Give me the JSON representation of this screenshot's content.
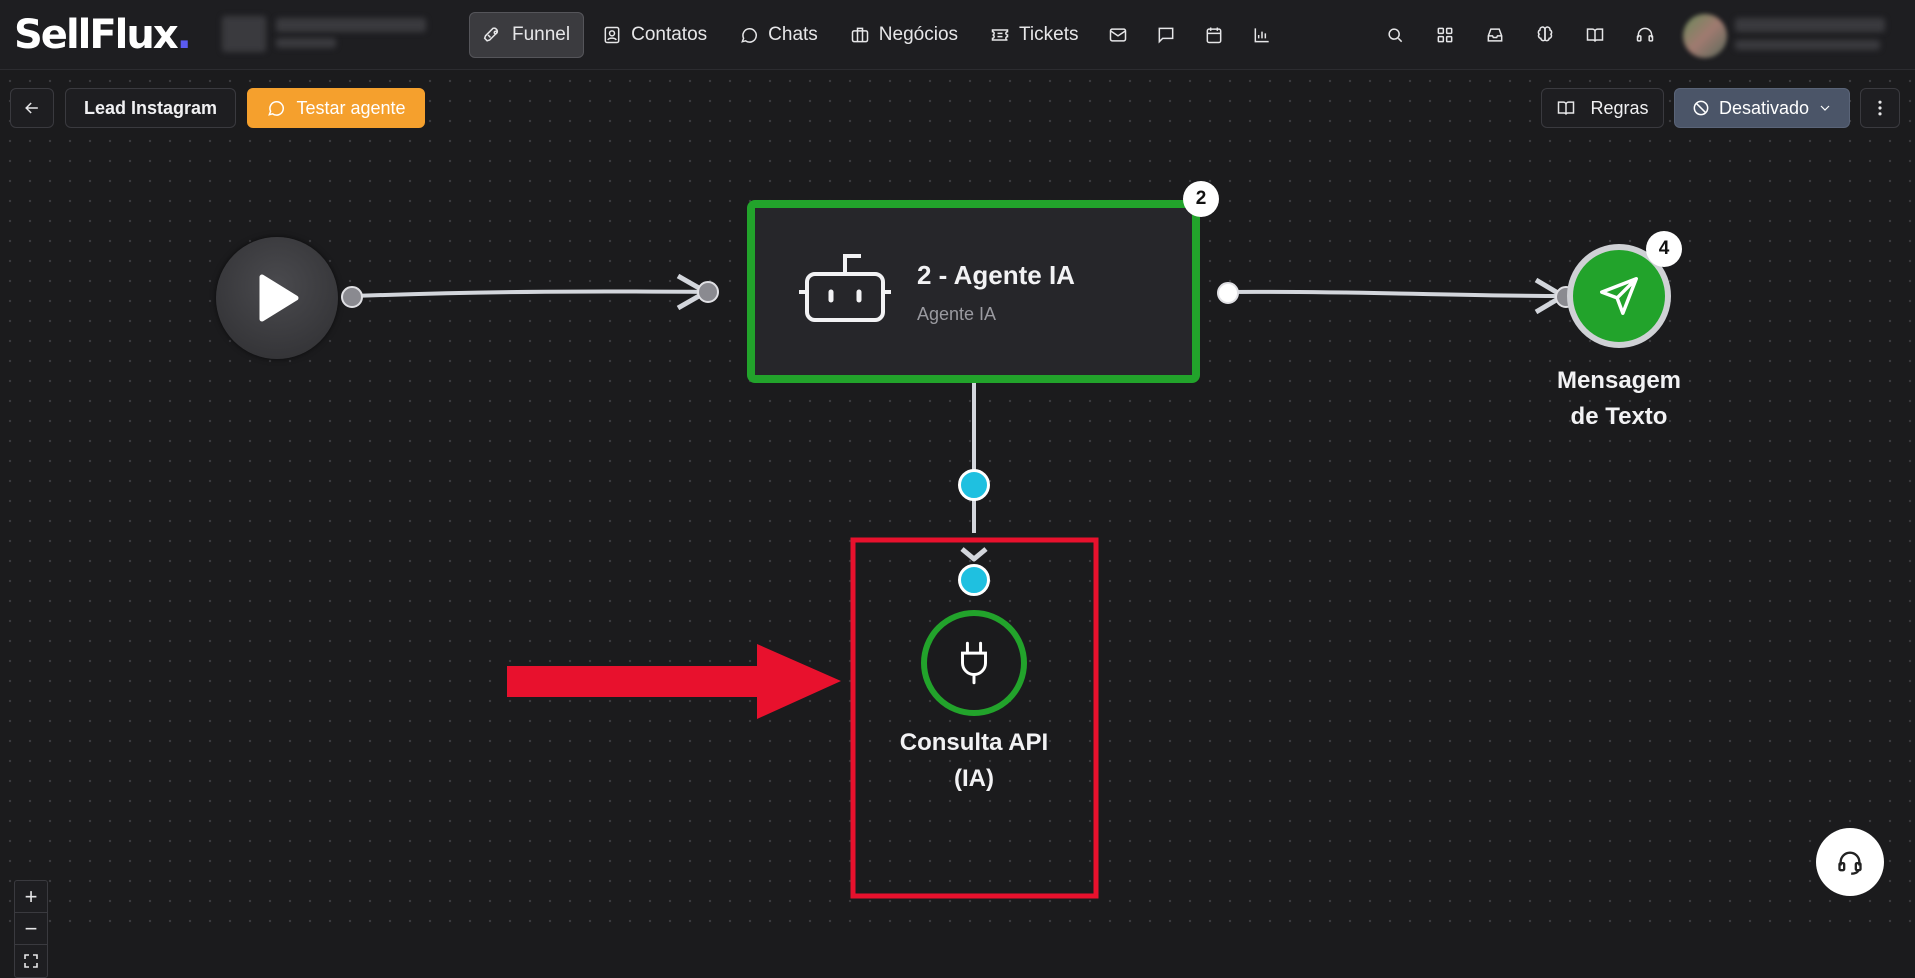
{
  "app": {
    "logo_text": "SellFlux",
    "logo_dot": "."
  },
  "nav": {
    "items": [
      {
        "label": "Funnel",
        "icon": "rocket-icon",
        "active": true
      },
      {
        "label": "Contatos",
        "icon": "contact-card-icon",
        "active": false
      },
      {
        "label": "Chats",
        "icon": "chat-bubble-icon",
        "active": false
      },
      {
        "label": "Negócios",
        "icon": "briefcase-icon",
        "active": false
      },
      {
        "label": "Tickets",
        "icon": "ticket-icon",
        "active": false
      }
    ],
    "icon_only": [
      "mail-icon",
      "message-square-icon",
      "calendar-icon",
      "bar-chart-icon"
    ]
  },
  "header_right_icons": [
    "search-icon",
    "apps-grid-icon",
    "inbox-icon",
    "brain-icon",
    "book-open-icon",
    "headset-icon"
  ],
  "toolbar": {
    "back_icon": "arrow-left-icon",
    "funnel_name": "Lead Instagram",
    "test_agent_label": "Testar agente",
    "rules_label": "Regras",
    "status_label": "Desativado",
    "more_icon": "more-vertical-icon"
  },
  "flow": {
    "start_icon": "play-icon",
    "agent_node": {
      "title": "2 - Agente IA",
      "subtitle": "Agente IA",
      "badge": "2",
      "icon": "robot-icon"
    },
    "message_node": {
      "label_line1": "Mensagem",
      "label_line2": "de Texto",
      "badge": "4",
      "icon": "send-icon"
    },
    "api_node": {
      "label_line1": "Consulta API",
      "label_line2": "(IA)",
      "icon": "plug-icon"
    }
  },
  "zoom_controls": {
    "zoom_in": "+",
    "zoom_out": "−",
    "fit_icon": "fit-view-icon"
  },
  "colors": {
    "accent_green": "#22a32b",
    "connector_cyan": "#1fc0e0",
    "highlight_red": "#e8112d",
    "test_button_orange": "#f5a02d",
    "status_button": "#4b5568"
  },
  "help_icon": "headset-icon"
}
